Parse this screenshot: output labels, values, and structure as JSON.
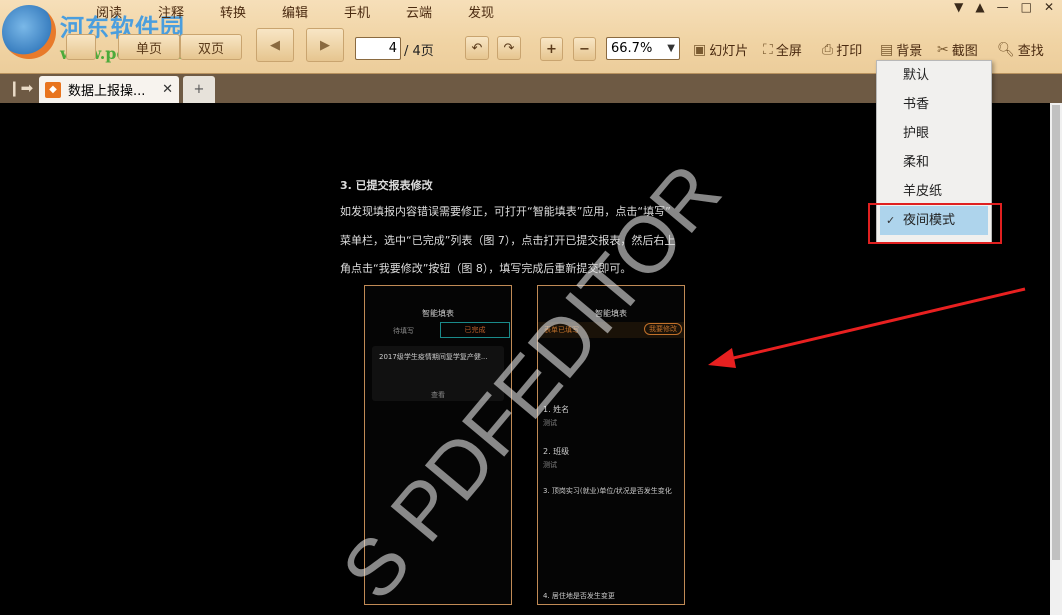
{
  "logo": {
    "title": "河东软件园",
    "url": "www.pc0359.cn"
  },
  "menu": [
    "阅读",
    "注释",
    "转换",
    "编辑",
    "手机",
    "云端",
    "发现"
  ],
  "toolbar": {
    "single_page": "单页",
    "double_page": "双页",
    "prev": "◀",
    "next": "▶",
    "current_page": "4",
    "total_pages": "/ 4页",
    "zoom": "66.7%",
    "slideshow": "幻灯片",
    "fullscreen": "全屏",
    "print": "打印",
    "background": "背景",
    "screenshot": "截图",
    "find": "查找"
  },
  "tabs": [
    {
      "label": "数据上报操..."
    }
  ],
  "document": {
    "heading": "3. 已提交报表修改",
    "lines": [
      "如发现填报内容错误需要修正，可打开“智能填表”应用，点击“填写”",
      "菜单栏，选中“已完成”列表（图 7），点击打开已提交报表，然后右上",
      "角点击“我要修改”按钮（图 8），填写完成后重新提交即可。"
    ],
    "phone1": {
      "title": "智能填表",
      "tab_pending": "待填写",
      "tab_done": "已完成",
      "card_title": "2017级学生疫情期间复学复产健...",
      "view": "查看"
    },
    "phone2": {
      "title": "智能填表",
      "status": "表单已填写",
      "modify": "我要修改",
      "q1": "1. 姓名",
      "a1": "测试",
      "q2": "2. 班级",
      "a2": "测试",
      "q3": "3. 顶岗实习(就业)单位/状况是否发生变化",
      "q4": "4. 居住地是否发生变更"
    },
    "watermark": "S PDFEDITOR"
  },
  "background_menu": {
    "items": [
      "默认",
      "书香",
      "护眼",
      "柔和",
      "羊皮纸",
      "夜间模式"
    ],
    "selected": "夜间模式",
    "check": "✓"
  }
}
